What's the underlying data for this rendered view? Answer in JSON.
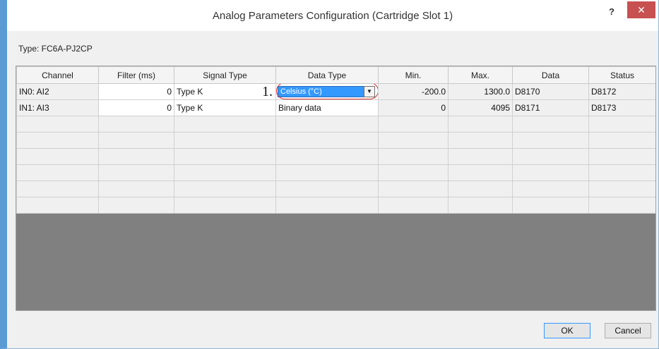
{
  "window": {
    "title": "Analog Parameters Configuration (Cartridge Slot 1)",
    "help": "?",
    "close": "✕"
  },
  "type_label": "Type: FC6A-PJ2CP",
  "grid": {
    "columns": [
      "Channel",
      "Filter (ms)",
      "Signal Type",
      "Data Type",
      "Min.",
      "Max.",
      "Data",
      "Status"
    ],
    "rows": [
      {
        "channel": "IN0: AI2",
        "filter": "0",
        "signal": "Type K",
        "data_type": "Celsius (°C)",
        "min": "-200.0",
        "max": "1300.0",
        "data": "D8170",
        "status": "D8172"
      },
      {
        "channel": "IN1: AI3",
        "filter": "0",
        "signal": "Type K",
        "data_type": "Binary data",
        "min": "0",
        "max": "4095",
        "data": "D8171",
        "status": "D8173"
      }
    ],
    "empty_rows": 6
  },
  "annotation": {
    "step": "1."
  },
  "buttons": {
    "ok": "OK",
    "cancel": "Cancel"
  }
}
